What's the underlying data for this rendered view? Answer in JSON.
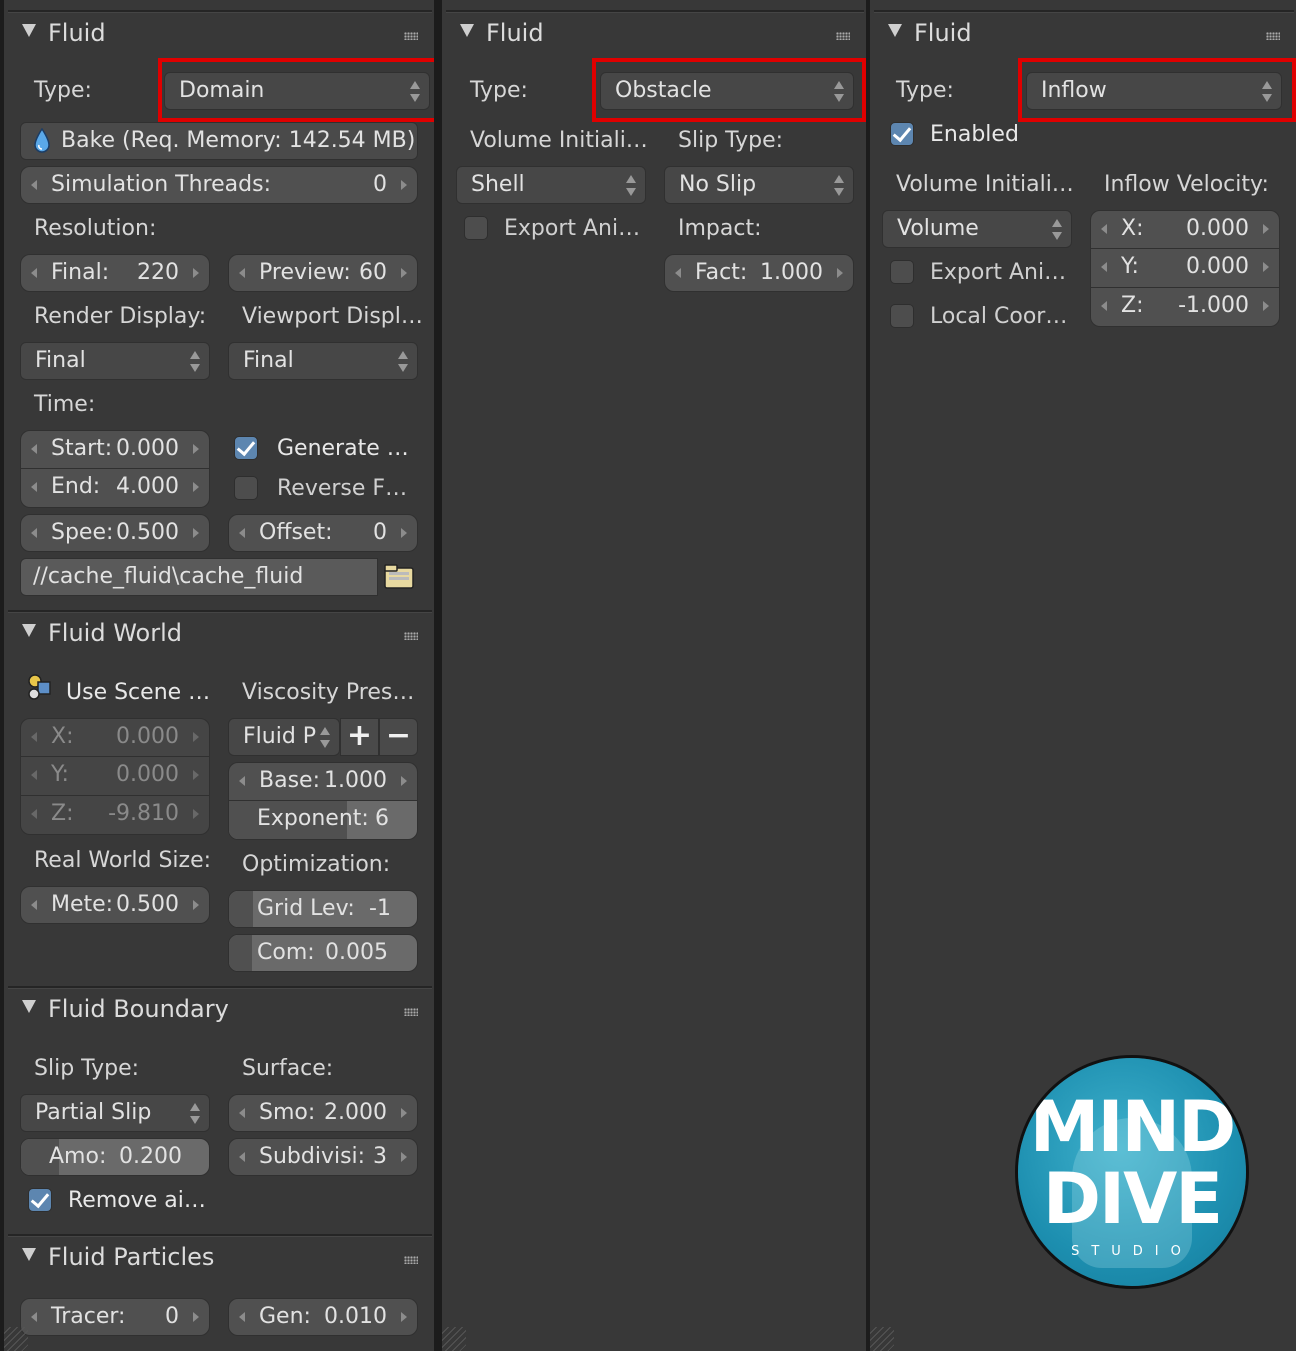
{
  "col1": {
    "fluid": {
      "title": "Fluid",
      "type_label": "Type:",
      "type_value": "Domain",
      "bake_label": "Bake (Req. Memory: 142.54 MB)",
      "threads_label": "Simulation Threads:",
      "threads_value": "0",
      "resolution_label": "Resolution:",
      "final_label": "Final:",
      "final_value": "220",
      "preview_label": "Preview:",
      "preview_value": "60",
      "render_display_label": "Render Display:",
      "viewport_display_label": "Viewport Displ…",
      "render_display_value": "Final",
      "viewport_display_value": "Final",
      "time_label": "Time:",
      "start_label": "Start:",
      "start_value": "0.000",
      "end_label": "End:",
      "end_value": "4.000",
      "generate_label": "Generate …",
      "generate_checked": true,
      "reverse_label": "Reverse F…",
      "reverse_checked": false,
      "speed_label": "Spee:",
      "speed_value": "0.500",
      "offset_label": "Offset:",
      "offset_value": "0",
      "cache_path": "//cache_fluid\\cache_fluid"
    },
    "world": {
      "title": "Fluid World",
      "use_scene_label": "Use Scene …",
      "viscosity_label": "Viscosity Pres…",
      "x_label": "X:",
      "x_value": "0.000",
      "y_label": "Y:",
      "y_value": "0.000",
      "z_label": "Z:",
      "z_value": "-9.810",
      "preset_value": "Fluid P",
      "add_glyph": "+",
      "remove_glyph": "−",
      "base_label": "Base:",
      "base_value": "1.000",
      "exponent_label": "Exponent:",
      "exponent_value": "6",
      "exponent_fraction": 0.625,
      "real_world_label": "Real World Size:",
      "optimization_label": "Optimization:",
      "meters_label": "Mete:",
      "meters_value": "0.500",
      "grid_label": "Grid Lev:",
      "grid_value": "-1",
      "grid_fraction": 0.13,
      "com_label": "Com:",
      "com_value": "0.005",
      "com_fraction": 0.12
    },
    "boundary": {
      "title": "Fluid Boundary",
      "slip_type_label": "Slip Type:",
      "surface_label": "Surface:",
      "slip_type_value": "Partial Slip",
      "smooth_label": "Smo:",
      "smooth_value": "2.000",
      "amount_label": "Amo:",
      "amount_value": "0.200",
      "amount_fraction": 0.2,
      "subdiv_label": "Subdivisi:",
      "subdiv_value": "3",
      "remove_air_label": "Remove ai…",
      "remove_air_checked": true
    },
    "particles": {
      "title": "Fluid Particles",
      "tracer_label": "Tracer:",
      "tracer_value": "0",
      "gen_label": "Gen:",
      "gen_value": "0.010"
    }
  },
  "col2": {
    "title": "Fluid",
    "type_label": "Type:",
    "type_value": "Obstacle",
    "volume_init_label": "Volume Initiali…",
    "slip_type_label": "Slip Type:",
    "volume_init_value": "Shell",
    "slip_type_value": "No Slip",
    "export_label": "Export Ani…",
    "export_checked": false,
    "impact_label": "Impact:",
    "fact_label": "Fact:",
    "fact_value": "1.000"
  },
  "col3": {
    "title": "Fluid",
    "type_label": "Type:",
    "type_value": "Inflow",
    "enabled_label": "Enabled",
    "enabled_checked": true,
    "volume_init_label": "Volume Initiali…",
    "inflow_velocity_label": "Inflow Velocity:",
    "volume_init_value": "Volume",
    "x_label": "X:",
    "x_value": "0.000",
    "y_label": "Y:",
    "y_value": "0.000",
    "z_label": "Z:",
    "z_value": "-1.000",
    "export_label": "Export Ani…",
    "export_checked": false,
    "local_coords_label": "Local Coor…",
    "local_coords_checked": false
  },
  "logo": {
    "line1": "MIND",
    "line2": "DIVE",
    "line3": "STUDIO"
  },
  "colors": {
    "highlight": "#e00000",
    "checkbox_on": "#5d86b0",
    "panel_bg": "#383838"
  }
}
